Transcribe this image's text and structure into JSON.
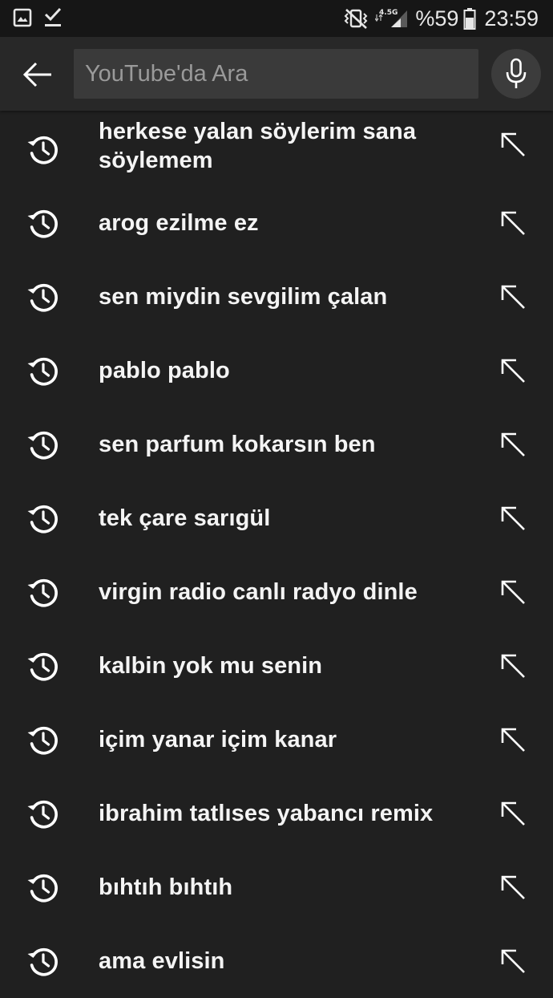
{
  "status_bar": {
    "left_icons": [
      "gallery-notification-icon",
      "download-complete-icon"
    ],
    "right_icons": [
      "vibrate-mode-icon",
      "mobile-data-icon",
      "signal-strength-icon",
      "battery-icon"
    ],
    "network_type": "4.5G",
    "battery_percent": "%59",
    "time": "23:59"
  },
  "search": {
    "back_icon": "arrow-back-icon",
    "placeholder": "YouTube'da Ara",
    "value": "",
    "mic_icon": "microphone-icon"
  },
  "suggestions": [
    {
      "text": "herkese yalan söylerim sana söylemem"
    },
    {
      "text": "arog ezilme ez"
    },
    {
      "text": "sen miydin sevgilim çalan"
    },
    {
      "text": "pablo pablo"
    },
    {
      "text": "sen parfum kokarsın ben"
    },
    {
      "text": "tek çare sarıgül"
    },
    {
      "text": "virgin radio canlı radyo dinle"
    },
    {
      "text": "kalbin yok mu senin"
    },
    {
      "text": "içim yanar içim kanar"
    },
    {
      "text": "ibrahim tatlıses yabancı remix"
    },
    {
      "text": "bıhtıh bıhtıh"
    },
    {
      "text": "ama evlisin"
    }
  ],
  "colors": {
    "background": "#202020",
    "header": "#282828",
    "search_box": "#3a3a3a",
    "text": "#f4f4f4",
    "placeholder": "#9a9a9a"
  }
}
